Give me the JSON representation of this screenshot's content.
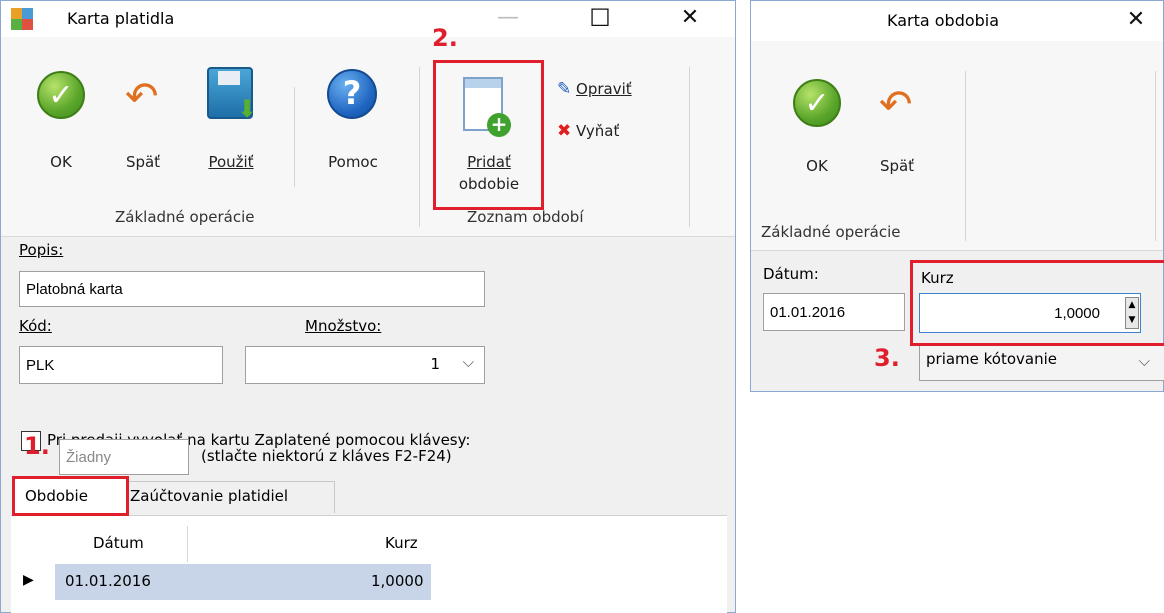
{
  "left_window": {
    "title": "Karta platidla",
    "ribbon": {
      "ok_label": "OK",
      "back_label": "Späť",
      "apply_label": "Použiť",
      "help_label": "Pomoc",
      "group_basic": "Základné operácie",
      "add_period_line1": "Pridať",
      "add_period_line2": "obdobie",
      "edit_label": "Opraviť",
      "remove_label": "Vyňať",
      "group_periods": "Zoznam období"
    },
    "form": {
      "description_label": "Popis:",
      "description_value": "Platobná karta",
      "code_label": "Kód:",
      "code_value": "PLK",
      "quantity_label": "Množstvo:",
      "quantity_value": "1",
      "checkbox_label": "Pri predaji vyvolať na kartu Zaplatené pomocou klávesy:",
      "key_value": "Žiadny",
      "key_hint": "(stlačte niektorú z kláves F2-F24)"
    },
    "tabs": [
      "Obdobie",
      "Zaúčtovanie platidiel"
    ],
    "table": {
      "columns": [
        "Dátum",
        "Kurz"
      ],
      "rows": [
        [
          "01.01.2016",
          "1,0000"
        ]
      ]
    }
  },
  "right_window": {
    "title": "Karta obdobia",
    "ribbon": {
      "ok_label": "OK",
      "back_label": "Späť",
      "group_basic": "Základné operácie"
    },
    "form": {
      "date_label": "Dátum:",
      "date_value": "01.01.2016",
      "rate_label": "Kurz",
      "rate_value": "1,0000",
      "quote_type": "priame kótovanie"
    }
  },
  "annotations": [
    "1.",
    "2.",
    "3."
  ],
  "colors": {
    "highlight": "#e01e2c",
    "row_selected": "#c8d4e8"
  }
}
